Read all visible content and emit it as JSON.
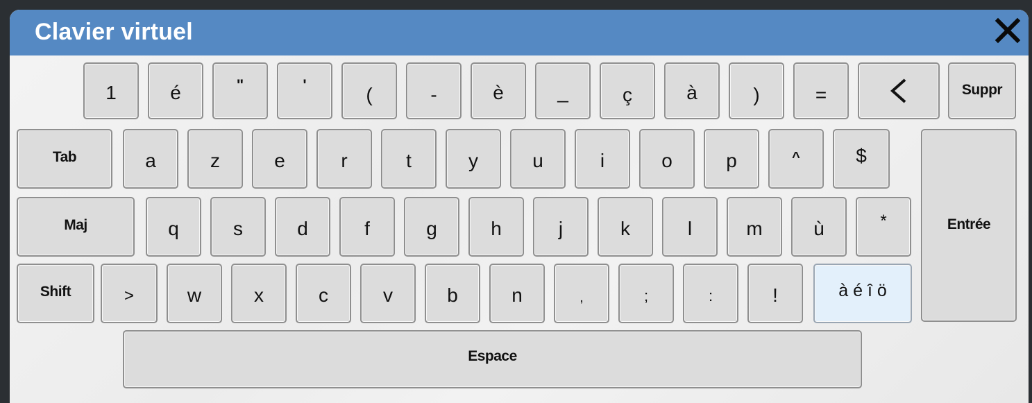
{
  "window": {
    "title": "Clavier virtuel",
    "close_icon": "close-icon",
    "titlebar_color": "#5589c3"
  },
  "keys": {
    "row1": [
      "1",
      "é",
      "\"",
      "'",
      "(",
      "-",
      "è",
      "_",
      "ç",
      "à",
      ")",
      "=",
      "<"
    ],
    "suppr": "Suppr",
    "tab": "Tab",
    "row2": [
      "a",
      "z",
      "e",
      "r",
      "t",
      "y",
      "u",
      "i",
      "o",
      "p",
      "^",
      "$"
    ],
    "maj": "Maj",
    "row3": [
      "q",
      "s",
      "d",
      "f",
      "g",
      "h",
      "j",
      "k",
      "l",
      "m",
      "ù",
      "*"
    ],
    "entree": "Entrée",
    "shift": "Shift",
    "row4": [
      ">",
      "w",
      "x",
      "c",
      "v",
      "b",
      "n",
      ",",
      ";",
      ":",
      "!"
    ],
    "accents": "à é î ö",
    "espace": "Espace"
  }
}
